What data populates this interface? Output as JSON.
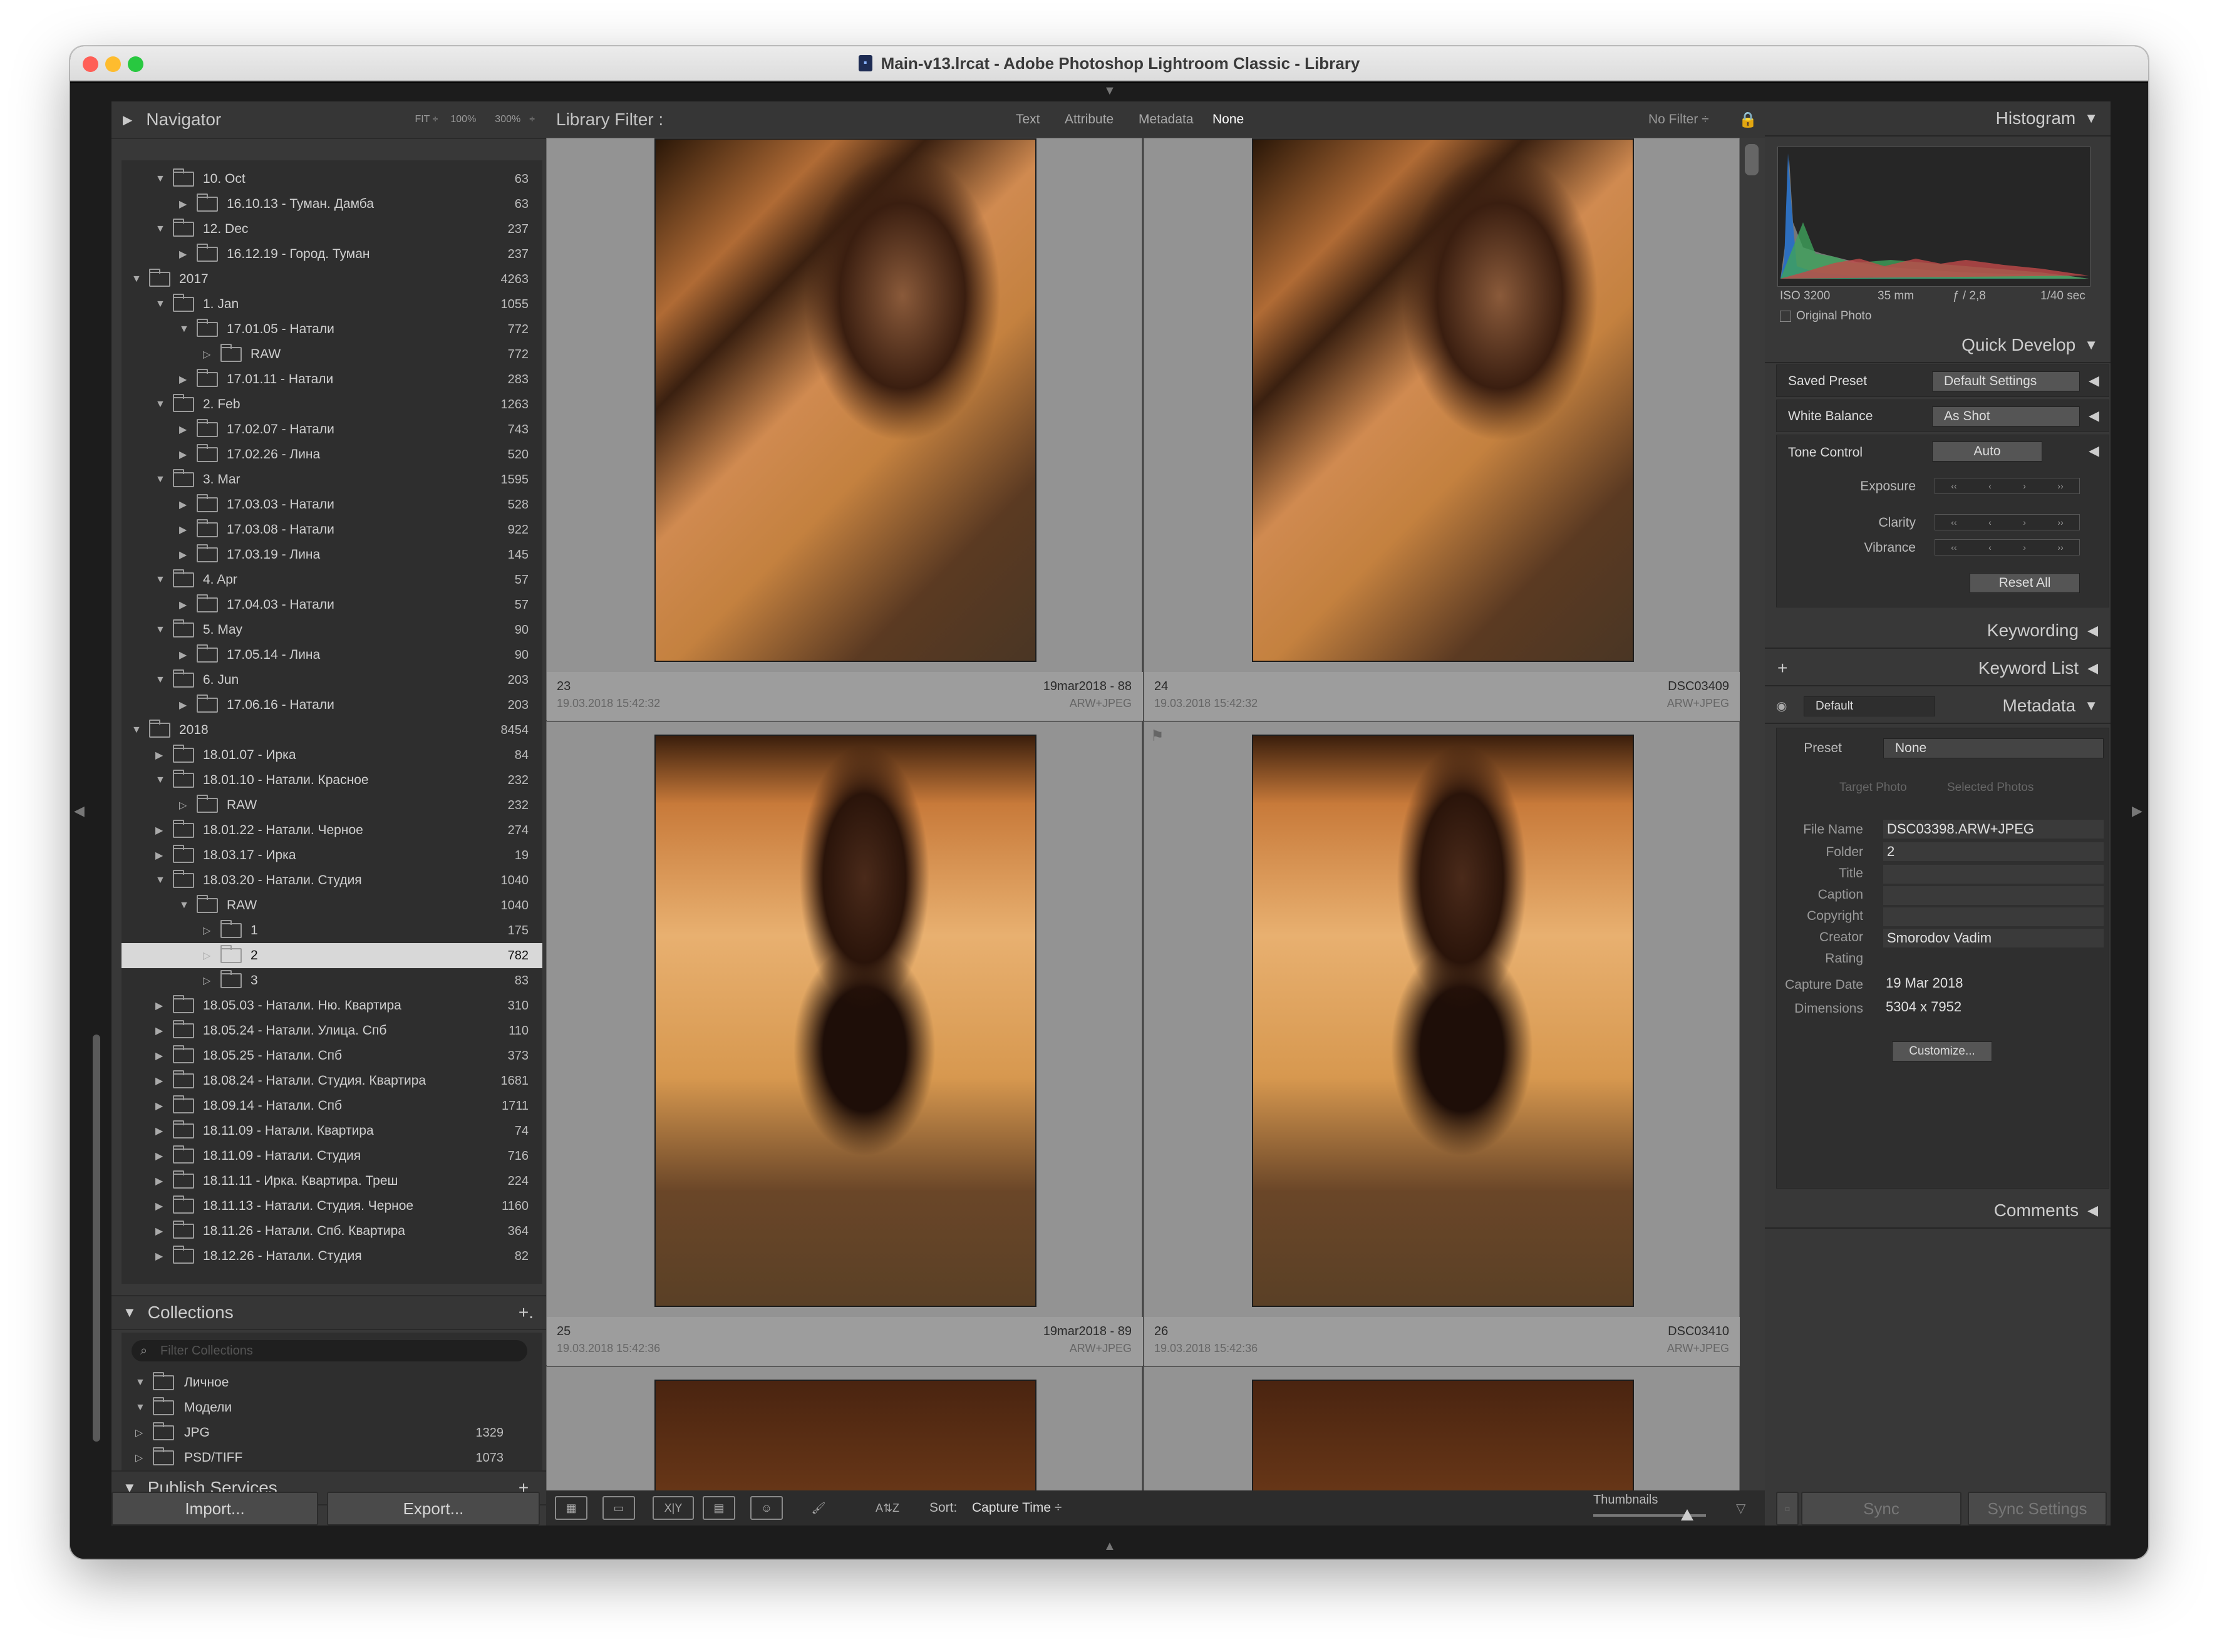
{
  "window": {
    "title": "Main-v13.lrcat - Adobe Photoshop Lightroom Classic - Library"
  },
  "navigator": {
    "title": "Navigator",
    "fit": "FIT ÷",
    "z100": "100%",
    "z300": "300%"
  },
  "folders": [
    {
      "label": "10. Oct",
      "count": "63",
      "level": 1,
      "tri": "▼"
    },
    {
      "label": "16.10.13 - Туман. Дамба",
      "count": "63",
      "level": 2,
      "tri": "▶"
    },
    {
      "label": "12. Dec",
      "count": "237",
      "level": 1,
      "tri": "▼"
    },
    {
      "label": "16.12.19 - Город. Туман",
      "count": "237",
      "level": 2,
      "tri": "▶"
    },
    {
      "label": "2017",
      "count": "4263",
      "level": 0,
      "tri": "▼"
    },
    {
      "label": "1. Jan",
      "count": "1055",
      "level": 1,
      "tri": "▼"
    },
    {
      "label": "17.01.05 - Натали",
      "count": "772",
      "level": 2,
      "tri": "▼"
    },
    {
      "label": "RAW",
      "count": "772",
      "level": 3,
      "tri": "▷"
    },
    {
      "label": "17.01.11 - Натали",
      "count": "283",
      "level": 2,
      "tri": "▶"
    },
    {
      "label": "2. Feb",
      "count": "1263",
      "level": 1,
      "tri": "▼"
    },
    {
      "label": "17.02.07 - Натали",
      "count": "743",
      "level": 2,
      "tri": "▶"
    },
    {
      "label": "17.02.26 - Лина",
      "count": "520",
      "level": 2,
      "tri": "▶"
    },
    {
      "label": "3. Mar",
      "count": "1595",
      "level": 1,
      "tri": "▼"
    },
    {
      "label": "17.03.03 - Натали",
      "count": "528",
      "level": 2,
      "tri": "▶"
    },
    {
      "label": "17.03.08 - Натали",
      "count": "922",
      "level": 2,
      "tri": "▶"
    },
    {
      "label": "17.03.19 - Лина",
      "count": "145",
      "level": 2,
      "tri": "▶"
    },
    {
      "label": "4. Apr",
      "count": "57",
      "level": 1,
      "tri": "▼"
    },
    {
      "label": "17.04.03 - Натали",
      "count": "57",
      "level": 2,
      "tri": "▶"
    },
    {
      "label": "5. May",
      "count": "90",
      "level": 1,
      "tri": "▼"
    },
    {
      "label": "17.05.14 - Лина",
      "count": "90",
      "level": 2,
      "tri": "▶"
    },
    {
      "label": "6. Jun",
      "count": "203",
      "level": 1,
      "tri": "▼"
    },
    {
      "label": "17.06.16 - Натали",
      "count": "203",
      "level": 2,
      "tri": "▶"
    },
    {
      "label": "2018",
      "count": "8454",
      "level": 0,
      "tri": "▼"
    },
    {
      "label": "18.01.07 - Ирка",
      "count": "84",
      "level": 1,
      "tri": "▶"
    },
    {
      "label": "18.01.10 - Натали. Красное",
      "count": "232",
      "level": 1,
      "tri": "▼"
    },
    {
      "label": "RAW",
      "count": "232",
      "level": 2,
      "tri": "▷"
    },
    {
      "label": "18.01.22 - Натали. Черное",
      "count": "274",
      "level": 1,
      "tri": "▶"
    },
    {
      "label": "18.03.17 - Ирка",
      "count": "19",
      "level": 1,
      "tri": "▶"
    },
    {
      "label": "18.03.20 - Натали. Студия",
      "count": "1040",
      "level": 1,
      "tri": "▼"
    },
    {
      "label": "RAW",
      "count": "1040",
      "level": 2,
      "tri": "▼"
    },
    {
      "label": "1",
      "count": "175",
      "level": 3,
      "tri": "▷"
    },
    {
      "label": "2",
      "count": "782",
      "level": 3,
      "tri": "▷",
      "selected": true
    },
    {
      "label": "3",
      "count": "83",
      "level": 3,
      "tri": "▷"
    },
    {
      "label": "18.05.03 - Натали. Ню. Квартира",
      "count": "310",
      "level": 1,
      "tri": "▶"
    },
    {
      "label": "18.05.24 - Натали. Улица. Спб",
      "count": "110",
      "level": 1,
      "tri": "▶"
    },
    {
      "label": "18.05.25 - Натали. Спб",
      "count": "373",
      "level": 1,
      "tri": "▶"
    },
    {
      "label": "18.08.24 - Натали. Студия. Квартира",
      "count": "1681",
      "level": 1,
      "tri": "▶"
    },
    {
      "label": "18.09.14 - Натали. Спб",
      "count": "1711",
      "level": 1,
      "tri": "▶"
    },
    {
      "label": "18.11.09 - Натали. Квартира",
      "count": "74",
      "level": 1,
      "tri": "▶"
    },
    {
      "label": "18.11.09 - Натали. Студия",
      "count": "716",
      "level": 1,
      "tri": "▶"
    },
    {
      "label": "18.11.11 - Ирка. Квартира. Треш",
      "count": "224",
      "level": 1,
      "tri": "▶"
    },
    {
      "label": "18.11.13 - Натали. Студия. Черное",
      "count": "1160",
      "level": 1,
      "tri": "▶"
    },
    {
      "label": "18.11.26 - Натали. Спб. Квартира",
      "count": "364",
      "level": 1,
      "tri": "▶"
    },
    {
      "label": "18.12.26 - Натали. Студия",
      "count": "82",
      "level": 1,
      "tri": "▶"
    }
  ],
  "collections": {
    "title": "Collections",
    "filter_placeholder": "Filter Collections",
    "items": [
      {
        "label": "Личное",
        "count": ""
      },
      {
        "label": "Модели",
        "count": ""
      },
      {
        "label": "JPG",
        "count": "1329"
      },
      {
        "label": "PSD/TIFF",
        "count": "1073"
      }
    ]
  },
  "publish": {
    "title": "Publish Services"
  },
  "buttons": {
    "import": "Import...",
    "export": "Export...",
    "sync": "Sync",
    "sync_settings": "Sync Settings"
  },
  "filter": {
    "title": "Library Filter :",
    "text": "Text",
    "attribute": "Attribute",
    "metadata": "Metadata",
    "none": "None",
    "no_filter": "No Filter ÷"
  },
  "grid": [
    {
      "num": "23",
      "name": "19mar2018 - 88",
      "date": "19.03.2018 15:42:32",
      "type": "ARW+JPEG"
    },
    {
      "num": "24",
      "name": "DSC03409",
      "date": "19.03.2018 15:42:32",
      "type": "ARW+JPEG"
    },
    {
      "num": "25",
      "name": "19mar2018 - 89",
      "date": "19.03.2018 15:42:36",
      "type": "ARW+JPEG"
    },
    {
      "num": "26",
      "name": "DSC03410",
      "date": "19.03.2018 15:42:36",
      "type": "ARW+JPEG"
    }
  ],
  "toolbar": {
    "sort_label": "Sort:",
    "sort_value": "Capture Time ÷",
    "thumbnails": "Thumbnails"
  },
  "histogram": {
    "title": "Histogram",
    "iso": "ISO 3200",
    "focal": "35 mm",
    "aperture": "ƒ / 2,8",
    "shutter": "1/40 sec",
    "original": "Original Photo"
  },
  "quick_develop": {
    "title": "Quick Develop",
    "saved_preset": "Saved Preset",
    "saved_preset_value": "Default Settings",
    "white_balance": "White Balance",
    "white_balance_value": "As Shot",
    "tone_control": "Tone Control",
    "auto": "Auto",
    "exposure": "Exposure",
    "clarity": "Clarity",
    "vibrance": "Vibrance",
    "reset": "Reset All"
  },
  "keywording": {
    "title": "Keywording"
  },
  "keyword_list": {
    "title": "Keyword List"
  },
  "metadata": {
    "title": "Metadata",
    "view": "Default",
    "preset_label": "Preset",
    "preset_value": "None",
    "target": "Target Photo",
    "selected": "Selected Photos",
    "file_name_label": "File Name",
    "file_name": "DSC03398.ARW+JPEG",
    "folder_label": "Folder",
    "folder": "2",
    "title_label": "Title",
    "caption_label": "Caption",
    "copyright_label": "Copyright",
    "creator_label": "Creator",
    "creator": "Smorodov Vadim",
    "rating_label": "Rating",
    "capture_label": "Capture Date",
    "capture": "19 Mar 2018",
    "dims_label": "Dimensions",
    "dims": "5304 x 7952",
    "customize": "Customize..."
  },
  "comments": {
    "title": "Comments"
  },
  "colors": {
    "accent": "#d8d8d8",
    "panel": "#383838",
    "center": "#404040"
  }
}
